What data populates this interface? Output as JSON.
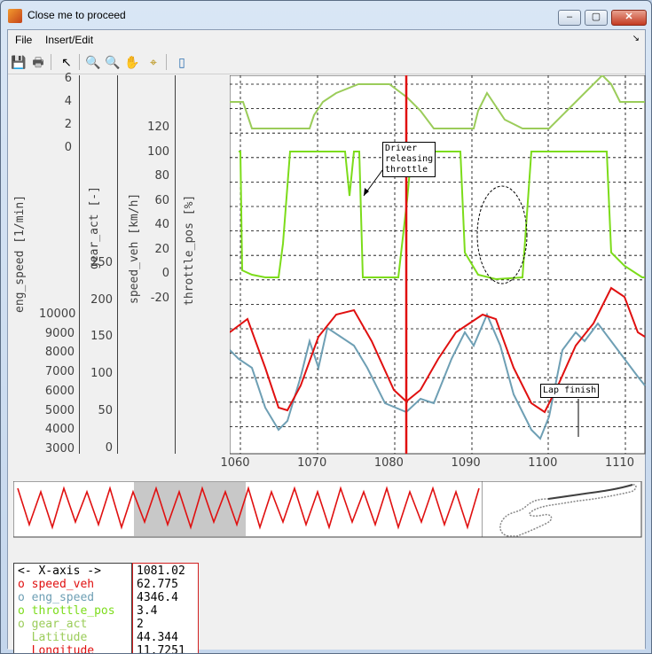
{
  "window": {
    "title": "Close me to proceed"
  },
  "menu": {
    "file": "File",
    "insert_edit": "Insert/Edit",
    "overflow": "↘"
  },
  "toolbar": {
    "save": "💾",
    "print": "🖶",
    "pointer": "↖",
    "zoom_in": "🔍",
    "zoom_out": "🔍",
    "pan": "✋",
    "data_cursor": "⌖",
    "colorbar": "▯"
  },
  "axes": {
    "eng_speed": {
      "label": "eng_speed [1/min]",
      "ticks": [
        "10000",
        "9000",
        "8000",
        "7000",
        "6000",
        "5000",
        "4000",
        "3000"
      ]
    },
    "gear_act": {
      "label": "gear_act [-]",
      "ticks": [
        "6",
        "4",
        "2",
        "0"
      ]
    },
    "speed_veh": {
      "label": "speed_veh [km/h]",
      "ticks": [
        "250",
        "200",
        "150",
        "100",
        "50",
        "0"
      ]
    },
    "throttle_pos": {
      "label": "throttle_pos [%]",
      "ticks": [
        "120",
        "100",
        "80",
        "60",
        "40",
        "20",
        "0",
        "-20"
      ]
    },
    "x_ticks": [
      "1060",
      "1070",
      "1080",
      "1090",
      "1100",
      "1110"
    ]
  },
  "annotations": {
    "driver_line1": "Driver",
    "driver_line2": "releasing",
    "driver_line3": "throttle",
    "lap_finish": "Lap finish"
  },
  "info": {
    "xaxis_label": "<- X-axis ->",
    "xaxis_value": "1081.02",
    "rows": [
      {
        "label": "o speed_veh",
        "value": "62.775",
        "color": "#e01010"
      },
      {
        "label": "o eng_speed",
        "value": "4346.4",
        "color": "#6e9fb4"
      },
      {
        "label": "o throttle_pos",
        "value": "3.4",
        "color": "#7cdc1a"
      },
      {
        "label": "o gear_act",
        "value": "2",
        "color": "#9bcc5a"
      },
      {
        "label": "  Latitude",
        "value": "44.344",
        "color": "#9bcc5a"
      },
      {
        "label": "  Longitude",
        "value": "11.7251",
        "color": "#e01010"
      }
    ]
  },
  "colors": {
    "speed": "#e01010",
    "rpm": "#6e9fb4",
    "throttle": "#7cdc1a",
    "gear": "#9bcc5a",
    "cursor": "#e01010"
  }
}
